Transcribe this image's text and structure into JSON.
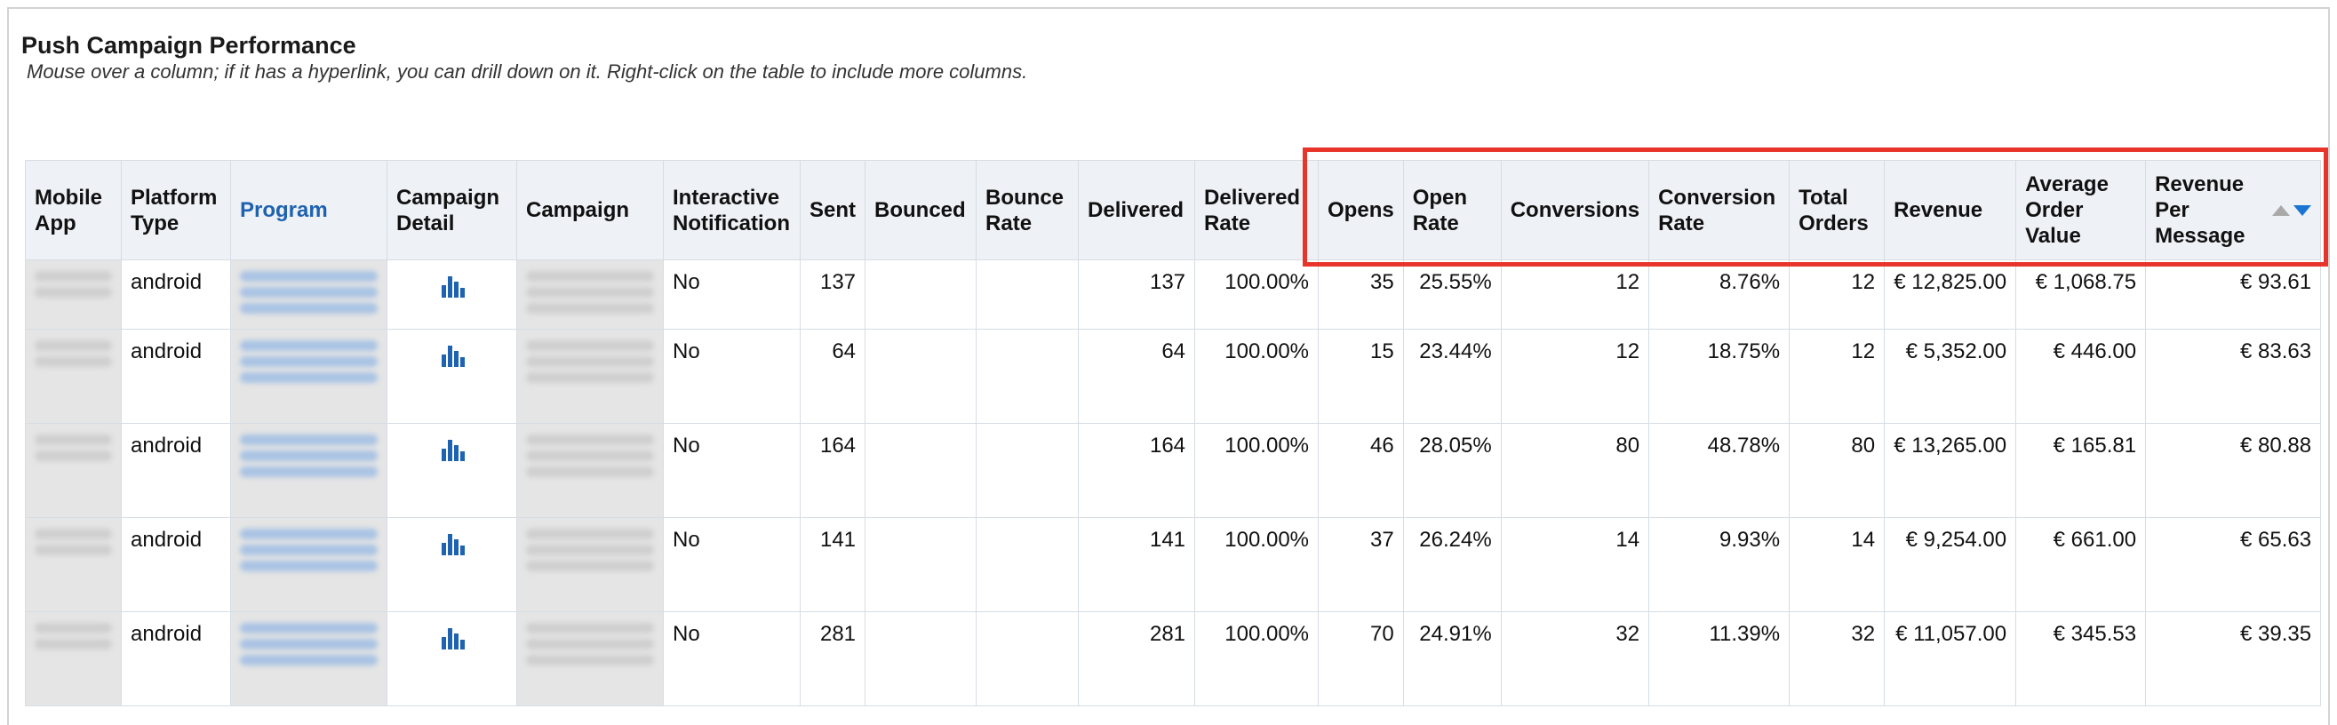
{
  "report": {
    "title": "Push Campaign Performance",
    "hint": "Mouse over a column; if it has a hyperlink, you can drill down on it. Right-click on the table to include more columns."
  },
  "columns": [
    {
      "label": "Mobile App"
    },
    {
      "label": "Platform Type"
    },
    {
      "label": "Program"
    },
    {
      "label": "Campaign Detail"
    },
    {
      "label": "Campaign"
    },
    {
      "label": "Interactive Notification"
    },
    {
      "label": "Sent"
    },
    {
      "label": "Bounced"
    },
    {
      "label": "Bounce Rate"
    },
    {
      "label": "Delivered"
    },
    {
      "label": "Delivered Rate"
    },
    {
      "label": "Opens"
    },
    {
      "label": "Open Rate"
    },
    {
      "label": "Conversions"
    },
    {
      "label": "Conversion Rate"
    },
    {
      "label": "Total Orders"
    },
    {
      "label": "Revenue"
    },
    {
      "label": "Average Order Value"
    },
    {
      "label": "Revenue Per Message"
    }
  ],
  "rows": [
    {
      "platform": "android",
      "interactive": "No",
      "sent": "137",
      "bounced": "",
      "bounce_rate": "",
      "delivered": "137",
      "delivered_rate": "100.00%",
      "opens": "35",
      "open_rate": "25.55%",
      "conversions": "12",
      "conversion_rate": "8.76%",
      "total_orders": "12",
      "revenue": "€ 12,825.00",
      "aov": "€ 1,068.75",
      "rpm": "€ 93.61"
    },
    {
      "platform": "android",
      "interactive": "No",
      "sent": "64",
      "bounced": "",
      "bounce_rate": "",
      "delivered": "64",
      "delivered_rate": "100.00%",
      "opens": "15",
      "open_rate": "23.44%",
      "conversions": "12",
      "conversion_rate": "18.75%",
      "total_orders": "12",
      "revenue": "€ 5,352.00",
      "aov": "€ 446.00",
      "rpm": "€ 83.63"
    },
    {
      "platform": "android",
      "interactive": "No",
      "sent": "164",
      "bounced": "",
      "bounce_rate": "",
      "delivered": "164",
      "delivered_rate": "100.00%",
      "opens": "46",
      "open_rate": "28.05%",
      "conversions": "80",
      "conversion_rate": "48.78%",
      "total_orders": "80",
      "revenue": "€ 13,265.00",
      "aov": "€ 165.81",
      "rpm": "€ 80.88"
    },
    {
      "platform": "android",
      "interactive": "No",
      "sent": "141",
      "bounced": "",
      "bounce_rate": "",
      "delivered": "141",
      "delivered_rate": "100.00%",
      "opens": "37",
      "open_rate": "26.24%",
      "conversions": "14",
      "conversion_rate": "9.93%",
      "total_orders": "14",
      "revenue": "€ 9,254.00",
      "aov": "€ 661.00",
      "rpm": "€ 65.63"
    },
    {
      "platform": "android",
      "interactive": "No",
      "sent": "281",
      "bounced": "",
      "bounce_rate": "",
      "delivered": "281",
      "delivered_rate": "100.00%",
      "opens": "70",
      "open_rate": "24.91%",
      "conversions": "32",
      "conversion_rate": "11.39%",
      "total_orders": "32",
      "revenue": "€ 11,057.00",
      "aov": "€ 345.53",
      "rpm": "€ 39.35"
    }
  ],
  "icons": {
    "campaign_detail": "bar-chart-icon",
    "sort": "sort-arrows-icon"
  },
  "colors": {
    "link": "#1e62b0",
    "highlight": "#e8352c",
    "header_bg": "#eef1f5",
    "sort_active": "#1b74d4"
  }
}
